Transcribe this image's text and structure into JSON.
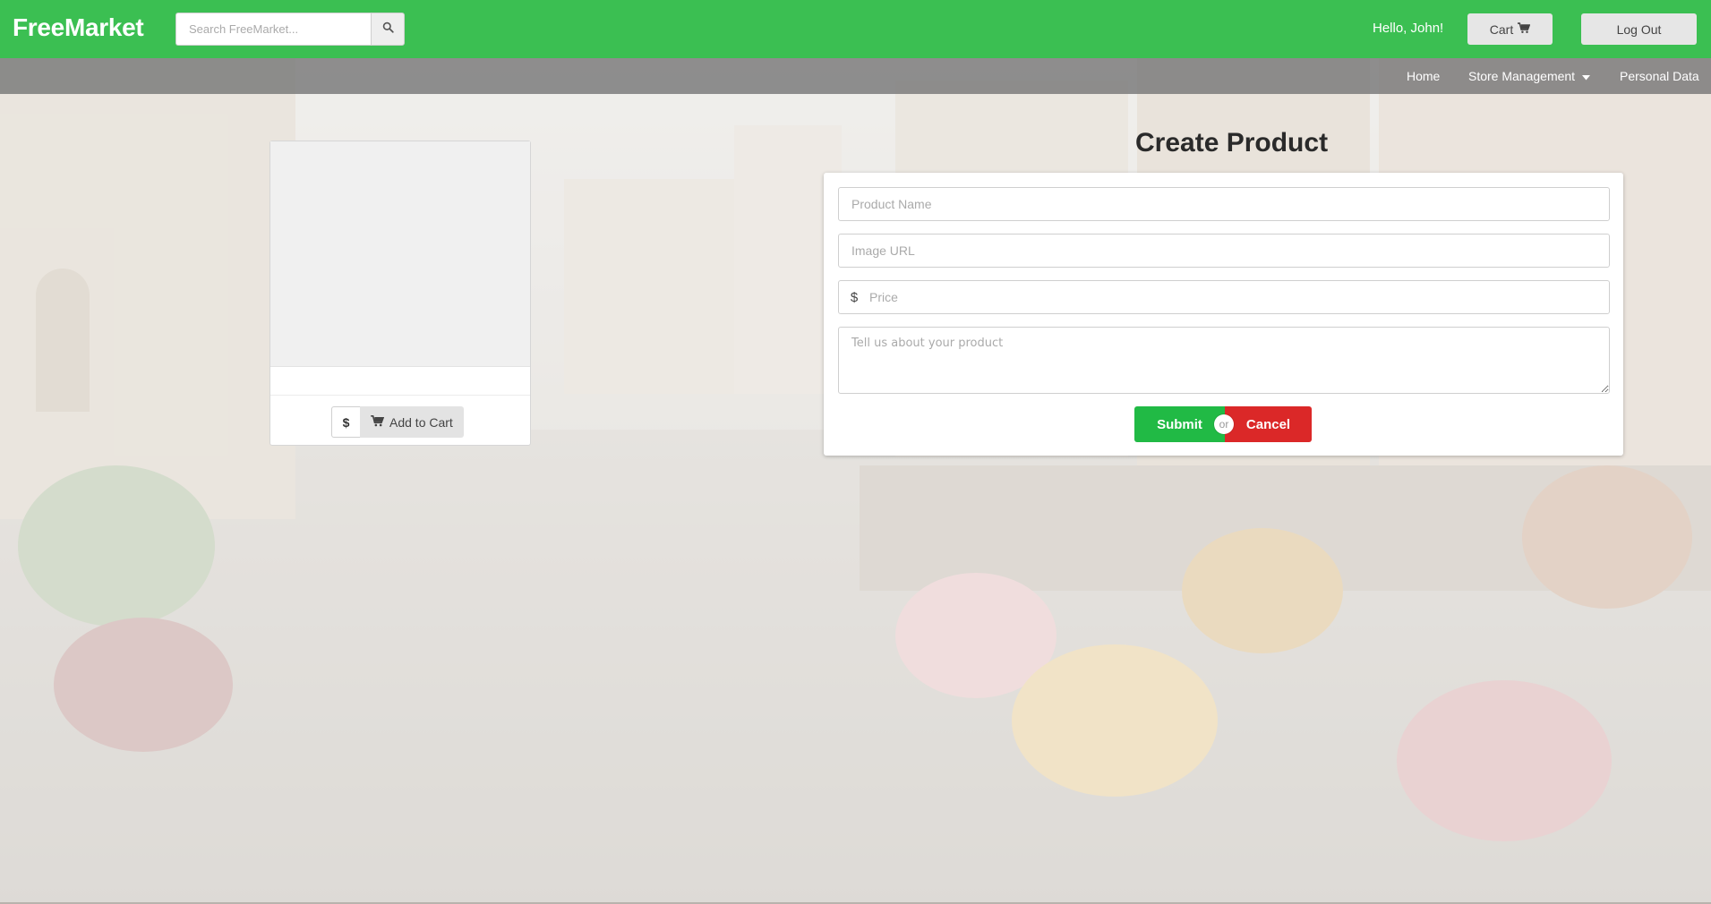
{
  "header": {
    "brand": "FreeMarket",
    "search_placeholder": "Search FreeMarket...",
    "search_icon": "search-icon",
    "greeting": "Hello, John!",
    "cart_label": "Cart",
    "cart_icon": "cart-icon",
    "logout_label": "Log Out",
    "accent_color": "#3bbf52"
  },
  "nav": {
    "home": "Home",
    "store_management": "Store Management",
    "personal_data": "Personal Data"
  },
  "preview": {
    "currency": "$",
    "add_to_cart": "Add to Cart"
  },
  "form": {
    "title": "Create Product",
    "product_name_placeholder": "Product Name",
    "image_url_placeholder": "Image URL",
    "price_symbol": "$",
    "price_placeholder": "Price",
    "description_placeholder": "Tell us about your product",
    "submit": "Submit",
    "or": "or",
    "cancel": "Cancel",
    "submit_color": "#21ba45",
    "cancel_color": "#db2828"
  }
}
